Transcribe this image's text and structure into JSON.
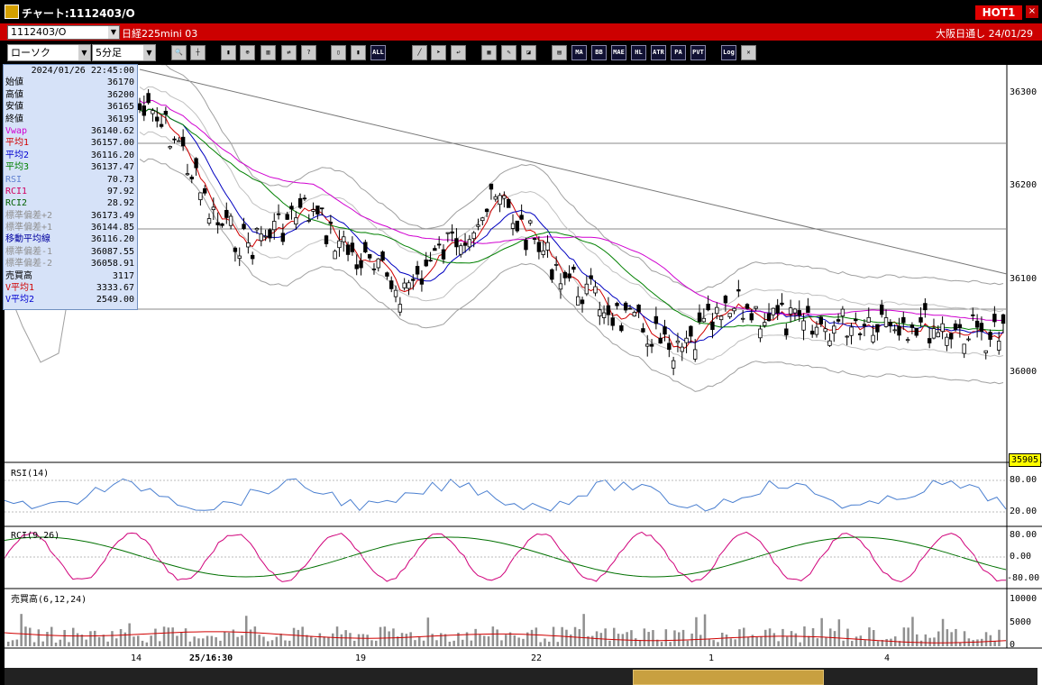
{
  "window": {
    "title": "チャート:1112403/O",
    "hot_button": "HOT1",
    "close": "×"
  },
  "infobar": {
    "code": "1112403/O",
    "name": "日経225mini 03",
    "session": "大阪日通し  24/01/29"
  },
  "toolbar": {
    "chart_type": "ローソク",
    "period": "5分足",
    "buttons": [
      "zoom",
      "draw",
      "candle",
      "magnify",
      "bar",
      "swap",
      "help",
      "candle2",
      "candle3",
      "all",
      "line",
      "cursor",
      "arrow",
      "tool",
      "pen",
      "color",
      "rain",
      "MA",
      "BB",
      "MAE",
      "HL",
      "ATR",
      "PA",
      "PVT",
      "Log",
      "close"
    ],
    "text_buttons": {
      "all": "ALL",
      "ma": "MA",
      "bb": "BB",
      "mae": "MAE",
      "hl": "HL",
      "atr": "ATR",
      "para": "PA RA",
      "pvt": "PVT",
      "log": "Log"
    }
  },
  "info_panel": {
    "datetime": "2024/01/26  22:45:00",
    "rows": [
      {
        "label": "始値",
        "value": "36170",
        "color": "#000000"
      },
      {
        "label": "高値",
        "value": "36200",
        "color": "#000000"
      },
      {
        "label": "安値",
        "value": "36165",
        "color": "#000000"
      },
      {
        "label": "終値",
        "value": "36195",
        "color": "#000000"
      },
      {
        "label": "Vwap",
        "value": "36140.62",
        "color": "#d000d0"
      },
      {
        "label": "平均1",
        "value": "36157.00",
        "color": "#d00000"
      },
      {
        "label": "平均2",
        "value": "36116.20",
        "color": "#0000d0"
      },
      {
        "label": "平均3",
        "value": "36137.47",
        "color": "#008000"
      },
      {
        "label": "RSI",
        "value": "70.73",
        "color": "#6080d0"
      },
      {
        "label": "RCI1",
        "value": "97.92",
        "color": "#d00060"
      },
      {
        "label": "RCI2",
        "value": "28.92",
        "color": "#006000"
      },
      {
        "label": "標準偏差+2",
        "value": "36173.49",
        "color": "#909090"
      },
      {
        "label": "標準偏差+1",
        "value": "36144.85",
        "color": "#909090"
      },
      {
        "label": "移動平均線",
        "value": "36116.20",
        "color": "#0000a0"
      },
      {
        "label": "標準偏差-1",
        "value": "36087.55",
        "color": "#909090"
      },
      {
        "label": "標準偏差-2",
        "value": "36058.91",
        "color": "#909090"
      },
      {
        "label": "売買高",
        "value": "3117",
        "color": "#000000"
      },
      {
        "label": "V平均1",
        "value": "3333.67",
        "color": "#d00000"
      },
      {
        "label": "V平均2",
        "value": "2549.00",
        "color": "#0000d0"
      }
    ]
  },
  "panels": {
    "rsi_label": "RSI(14)",
    "rci_label": "RCI(9,26)",
    "vol_label": "売買高(6,12,24)"
  },
  "axes": {
    "price_ticks": [
      "36300",
      "36200",
      "36100",
      "36000"
    ],
    "current_price": "35905",
    "rsi_ticks": [
      "80.00",
      "20.00"
    ],
    "rci_ticks": [
      "80.00",
      "0.00",
      "-80.00"
    ],
    "vol_ticks": [
      "10000",
      "5000",
      "0"
    ],
    "x_labels": [
      "14",
      "25/16:30",
      "19",
      "22",
      "1",
      "4"
    ]
  },
  "colors": {
    "bg": "#ffffff",
    "up": "#ffffff",
    "down": "#000000",
    "ma1": "#d00000",
    "ma2": "#0000c0",
    "ma3": "#008000",
    "vwap": "#d000d0",
    "band": "#a0a0a0",
    "rsi": "#4a7fd0",
    "rci1": "#d0007a",
    "rci2": "#007000",
    "vol": "#909090"
  },
  "chart_data": {
    "type": "candlestick",
    "price_range": [
      35905,
      36330
    ],
    "trend_line": {
      "from": 36330,
      "to": 36110
    },
    "horizontal_levels": [
      36245,
      36155,
      36065
    ]
  }
}
